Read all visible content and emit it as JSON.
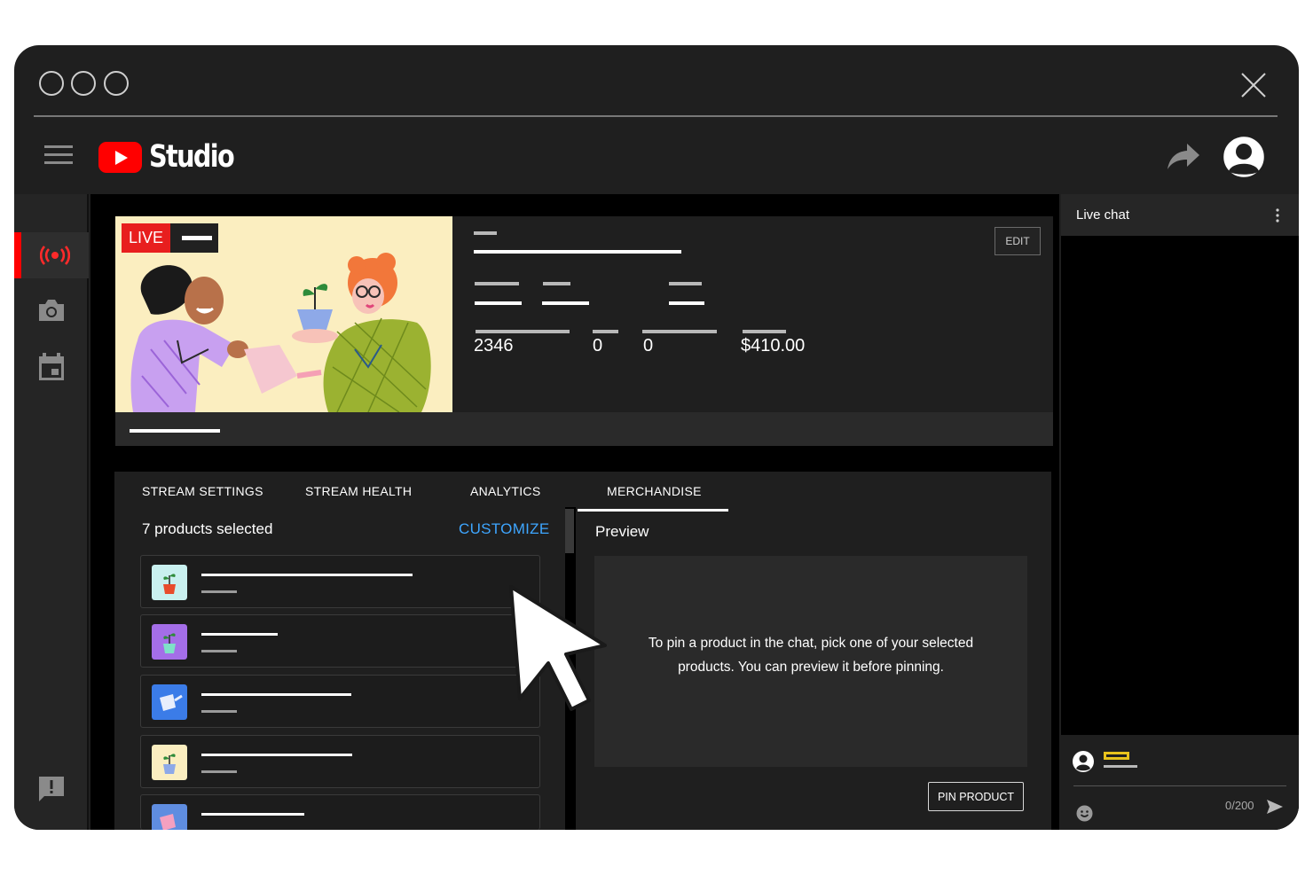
{
  "app": {
    "logo_text": "Studio",
    "brand_color": "#ff0000",
    "accent_color": "#3ea6ff"
  },
  "sidebar": {
    "items": [
      {
        "icon": "live-broadcast-icon",
        "active": true
      },
      {
        "icon": "camera-icon",
        "active": false
      },
      {
        "icon": "calendar-icon",
        "active": false
      },
      {
        "icon": "feedback-icon",
        "active": false
      }
    ]
  },
  "stream": {
    "live_label": "LIVE",
    "edit_label": "EDIT",
    "stats": [
      "2346",
      "0",
      "0",
      "$410.00"
    ]
  },
  "tabs": {
    "stream_settings": "STREAM SETTINGS",
    "stream_health": "STREAM HEALTH",
    "analytics": "ANALYTICS",
    "merchandise": "MERCHANDISE",
    "active": "MERCHANDISE"
  },
  "products": {
    "count_label": "7 products selected",
    "customize_label": "CUSTOMIZE",
    "items": [
      {
        "thumb_color": "#c9f0ef"
      },
      {
        "thumb_color": "#a46ee8"
      },
      {
        "thumb_color": "#3b7ce8"
      },
      {
        "thumb_color": "#fbeec0"
      },
      {
        "thumb_color": "#5f8de0"
      }
    ]
  },
  "preview": {
    "title": "Preview",
    "line1": "To pin a product in the chat, pick one of your selected",
    "line2": "products. You can preview it before pinning.",
    "pin_label": "PIN PRODUCT"
  },
  "chat": {
    "title": "Live chat",
    "char_count": "0/200"
  }
}
